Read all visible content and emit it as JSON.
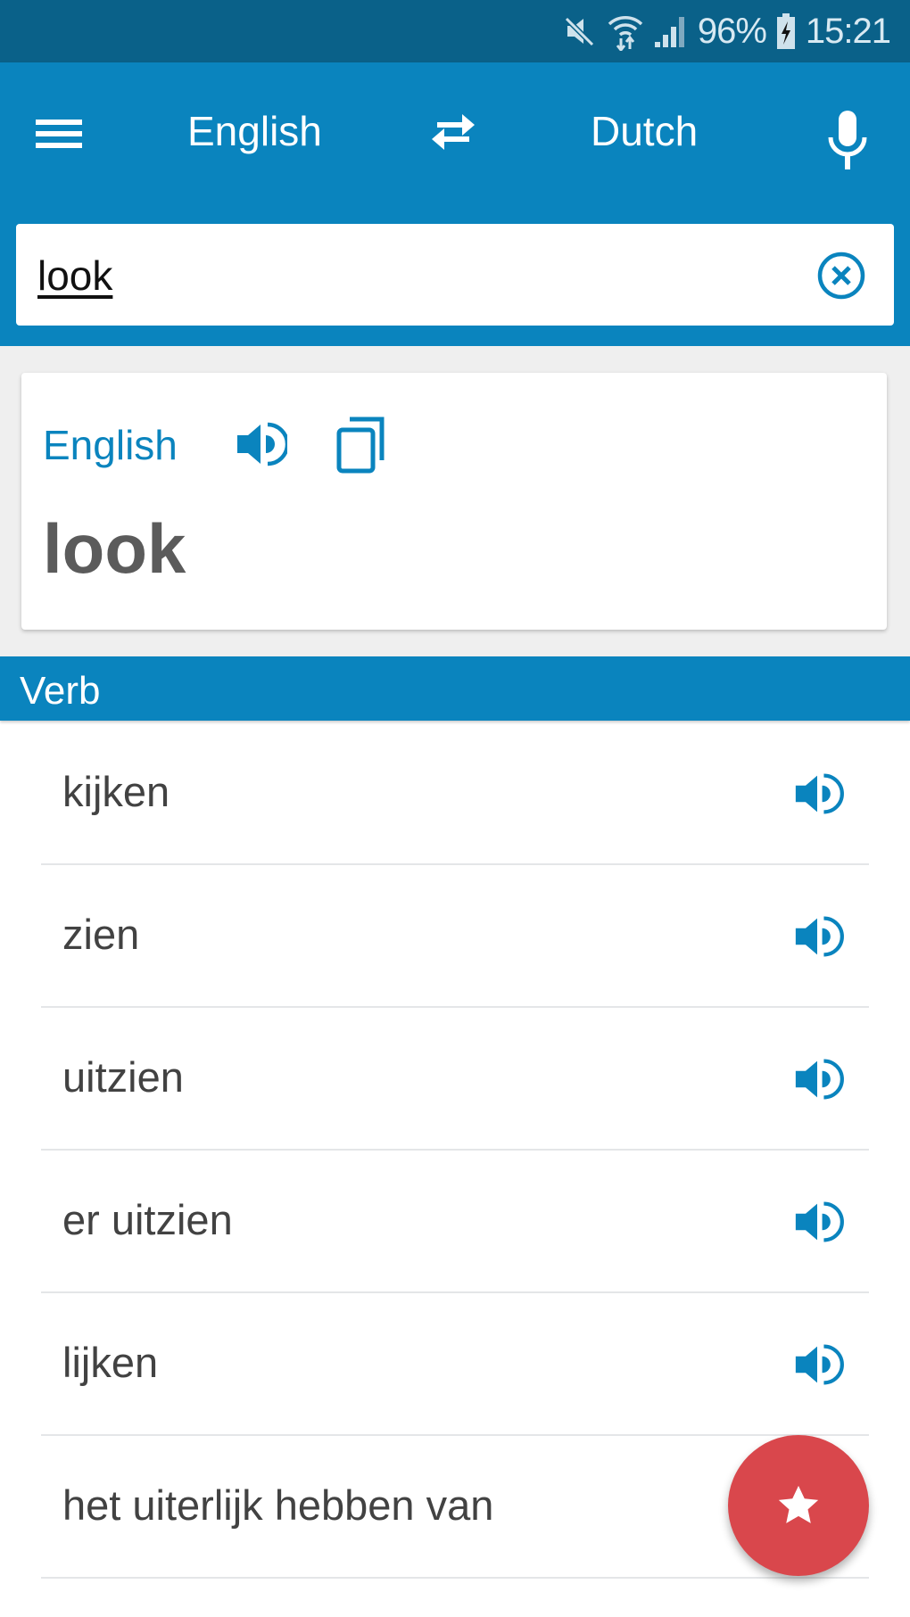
{
  "status_bar": {
    "icons": [
      "mute-icon",
      "wifi-icon",
      "signal-icon",
      "battery-charging-icon"
    ],
    "battery": "96%",
    "time": "15:21"
  },
  "app_bar": {
    "menu_icon": "menu-icon",
    "source_language": "English",
    "swap_icon": "swap-arrows-icon",
    "target_language": "Dutch",
    "mic_icon": "microphone-icon"
  },
  "search": {
    "value": "look",
    "placeholder": "",
    "clear_icon": "clear-circle-icon"
  },
  "word_card": {
    "language": "English",
    "speak_icon": "speaker-icon",
    "copy_icon": "copy-icon",
    "word": "look"
  },
  "section": {
    "label": "Verb"
  },
  "translations": [
    {
      "text": "kijken"
    },
    {
      "text": "zien"
    },
    {
      "text": "uitzien"
    },
    {
      "text": "er uitzien"
    },
    {
      "text": "lijken"
    },
    {
      "text": "het uiterlijk hebben van"
    }
  ],
  "fab": {
    "icon": "star-icon"
  },
  "colors": {
    "status_bar": "#0a6189",
    "primary": "#0a84be",
    "fab": "#d9474c",
    "text": "#424242"
  }
}
